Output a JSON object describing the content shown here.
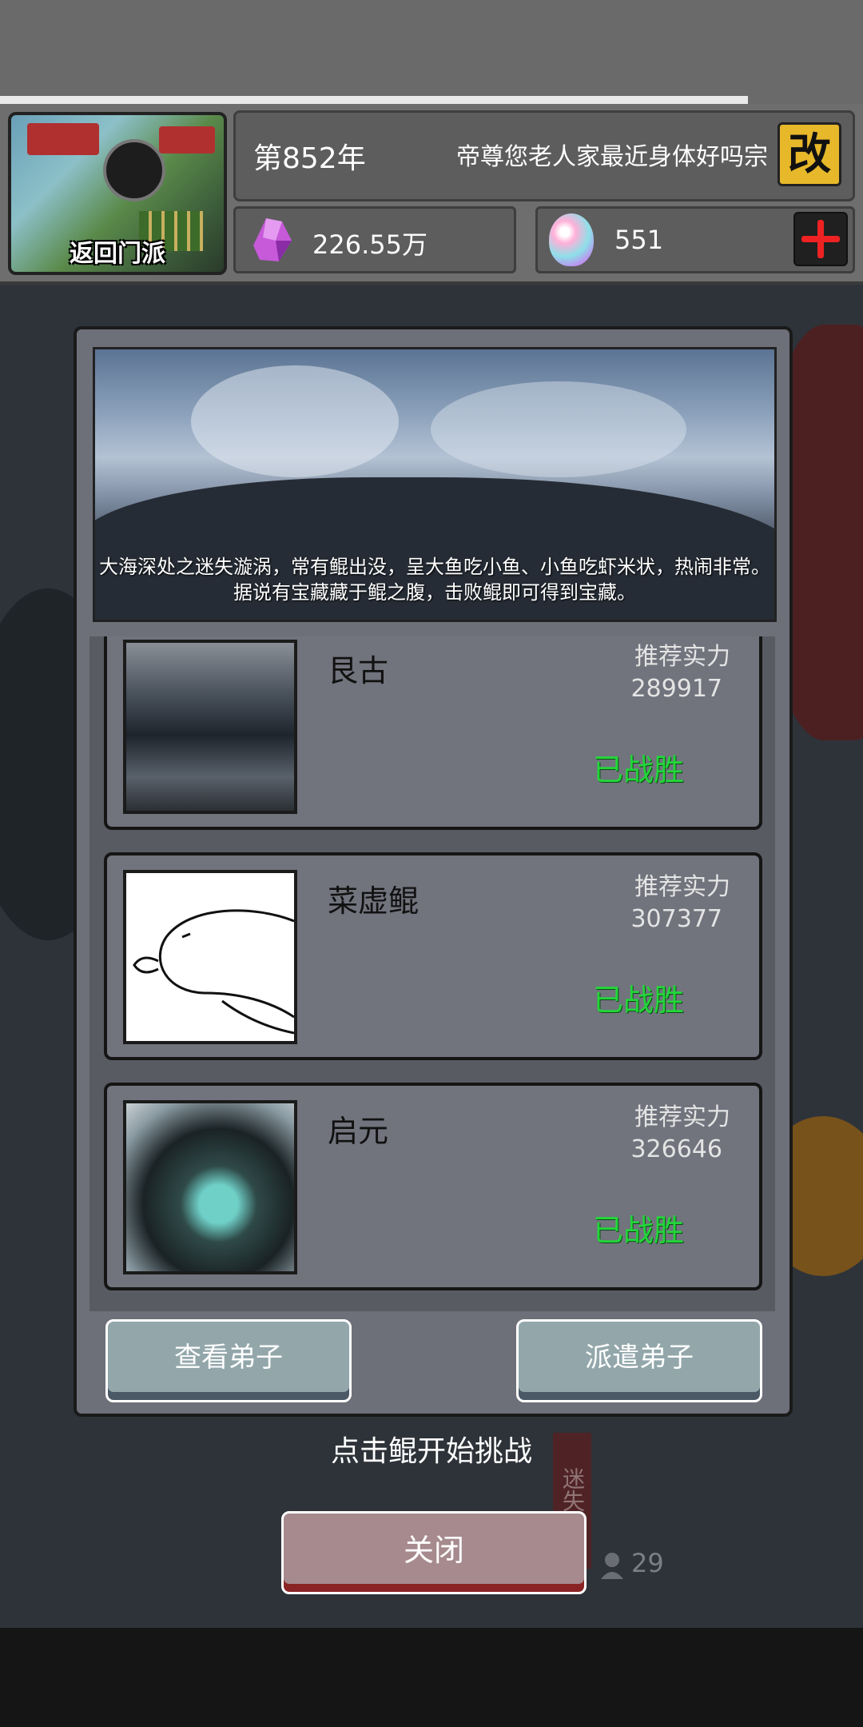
{
  "header": {
    "sect_button_label": "返回门派",
    "year": "第852年",
    "sect_name": "帝尊您老人家最近身体好吗宗",
    "rename_label": "改",
    "crystals": "226.55万",
    "eggs": "551"
  },
  "banner": {
    "description": "大海深处之迷失漩涡，常有鲲出没，呈大鱼吃小鱼、小鱼吃虾米状，热闹非常。据说有宝藏藏于鲲之腹，击败鲲即可得到宝藏。"
  },
  "bosses": [
    {
      "name": "艮古",
      "rec_label": "推荐实力",
      "rec_value": "289917",
      "status": "已战胜"
    },
    {
      "name": "菜虚鲲",
      "rec_label": "推荐实力",
      "rec_value": "307377",
      "status": "已战胜"
    },
    {
      "name": "启元",
      "rec_label": "推荐实力",
      "rec_value": "326646",
      "status": "已战胜"
    }
  ],
  "buttons": {
    "view_disciples": "查看弟子",
    "dispatch_disciples": "派遣弟子",
    "close": "关闭"
  },
  "hint": "点击鲲开始挑战",
  "side_tag": "迷失漩",
  "people_count": "29",
  "colors": {
    "victory_green": "#23d63a",
    "rename_gold": "#e7b82a",
    "plus_red": "#e22222",
    "teal_button": "#93a7ab",
    "close_button": "#a68a8d"
  }
}
